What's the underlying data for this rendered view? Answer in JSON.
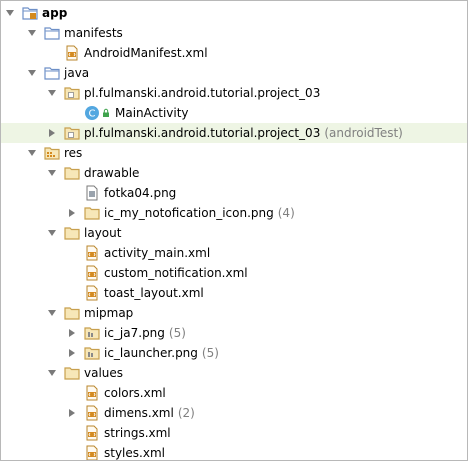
{
  "colors": {
    "folder_blue": "#6d8fc7",
    "folder_yellow": "#c8a04e",
    "class_circle": "#53a7e0",
    "xml_orange": "#d48a1f",
    "muted": "#808080",
    "highlight": "#eef5e4"
  },
  "tree": {
    "app": "app",
    "manifests": "manifests",
    "android_manifest": "AndroidManifest.xml",
    "java": "java",
    "pkg_main": "pl.fulmanski.android.tutorial.project_03",
    "class_badge": "C",
    "main_activity": "MainActivity",
    "pkg_test": "pl.fulmanski.android.tutorial.project_03",
    "pkg_test_suffix": "(androidTest)",
    "res": "res",
    "drawable": "drawable",
    "fotka": "fotka04.png",
    "ic_my_notif": "ic_my_notofication_icon.png",
    "ic_my_notif_count": "(4)",
    "layout": "layout",
    "activity_main": "activity_main.xml",
    "custom_notification": "custom_notification.xml",
    "toast_layout": "toast_layout.xml",
    "mipmap": "mipmap",
    "ic_ja7": "ic_ja7.png",
    "ic_ja7_count": "(5)",
    "ic_launcher": "ic_launcher.png",
    "ic_launcher_count": "(5)",
    "values": "values",
    "colors_xml": "colors.xml",
    "dimens_xml": "dimens.xml",
    "dimens_count": "(2)",
    "strings_xml": "strings.xml",
    "styles_xml": "styles.xml"
  }
}
